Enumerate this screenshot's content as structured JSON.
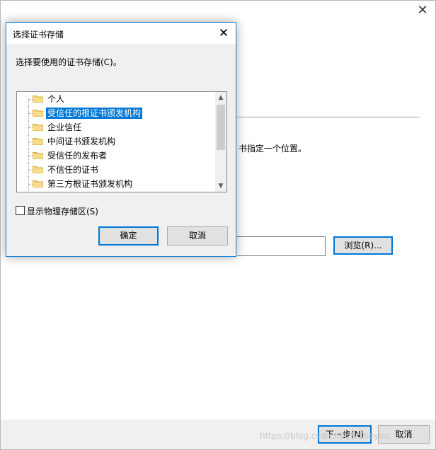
{
  "wizard": {
    "description": "书指定一个位置。",
    "browse_label": "浏览(R)...",
    "next_label": "下一步(N)",
    "cancel_label": "取消",
    "watermark": "https://blog.csdn.net/SrDIeyou"
  },
  "dialog": {
    "title": "选择证书存储",
    "prompt": "选择要使用的证书存储(C)。",
    "stores": [
      {
        "label": "个人",
        "selected": false
      },
      {
        "label": "受信任的根证书颁发机构",
        "selected": true
      },
      {
        "label": "企业信任",
        "selected": false
      },
      {
        "label": "中间证书颁发机构",
        "selected": false
      },
      {
        "label": "受信任的发布者",
        "selected": false
      },
      {
        "label": "不信任的证书",
        "selected": false
      },
      {
        "label": "第三方根证书颁发机构",
        "selected": false
      }
    ],
    "show_physical": {
      "label": "显示物理存储区(S)",
      "checked": false
    },
    "ok_label": "确定",
    "cancel_label": "取消"
  },
  "icons": {
    "folder": "folder-icon",
    "close": "close-icon",
    "scroll_up": "chevron-up-icon",
    "scroll_down": "chevron-down-icon"
  },
  "colors": {
    "accent": "#0078d7",
    "folder": "#f3d27a",
    "dialog_bg": "#f0f0f0"
  }
}
